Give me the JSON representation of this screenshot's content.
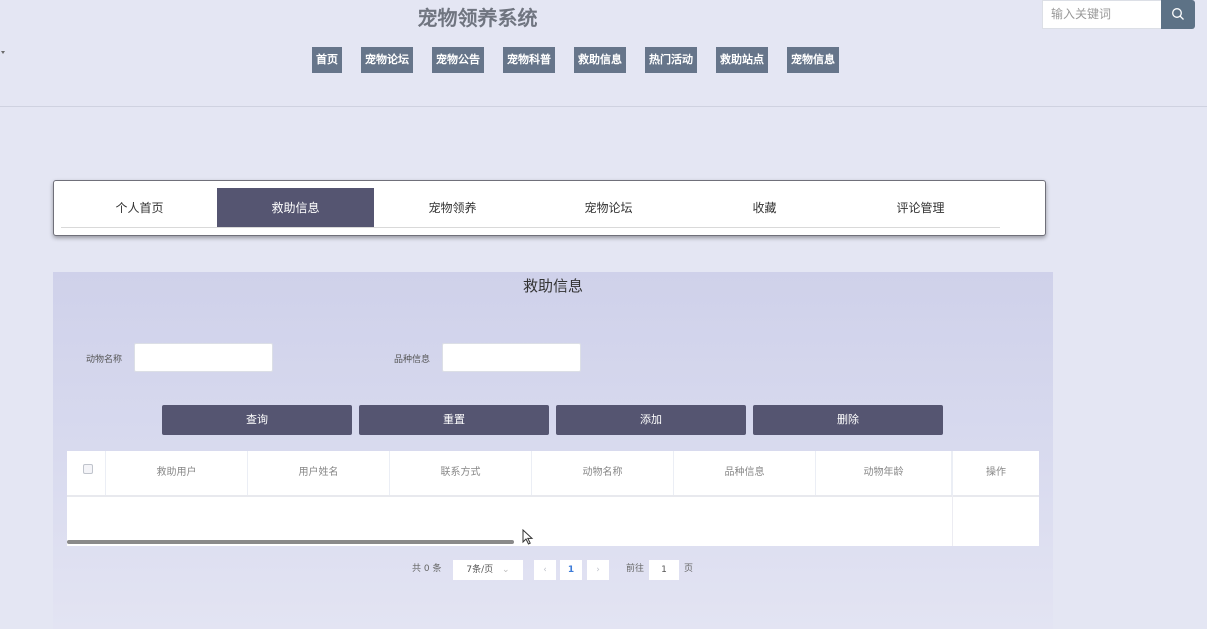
{
  "header": {
    "site_title": "宠物领养系统",
    "nav": [
      "首页",
      "宠物论坛",
      "宠物公告",
      "宠物科普",
      "救助信息",
      "热门活动",
      "救助站点",
      "宠物信息"
    ],
    "search_placeholder": "输入关键词",
    "search_icon": "search-icon"
  },
  "tabs": {
    "items": [
      "个人首页",
      "救助信息",
      "宠物领养",
      "宠物论坛",
      "收藏",
      "评论管理"
    ],
    "active": "救助信息"
  },
  "panel": {
    "title": "救助信息",
    "filters": [
      {
        "label": "动物名称",
        "value": ""
      },
      {
        "label": "品种信息",
        "value": ""
      }
    ],
    "buttons": [
      "查询",
      "重置",
      "添加",
      "删除"
    ],
    "table": {
      "columns": [
        "救助用户",
        "用户姓名",
        "联系方式",
        "动物名称",
        "品种信息",
        "动物年龄",
        "操作"
      ],
      "rows": []
    },
    "pagination": {
      "total": "共 0 条",
      "page_size": "7条/页",
      "current_page": "1",
      "goto_label": "前往",
      "goto_value": "1",
      "page_unit": "页"
    }
  }
}
